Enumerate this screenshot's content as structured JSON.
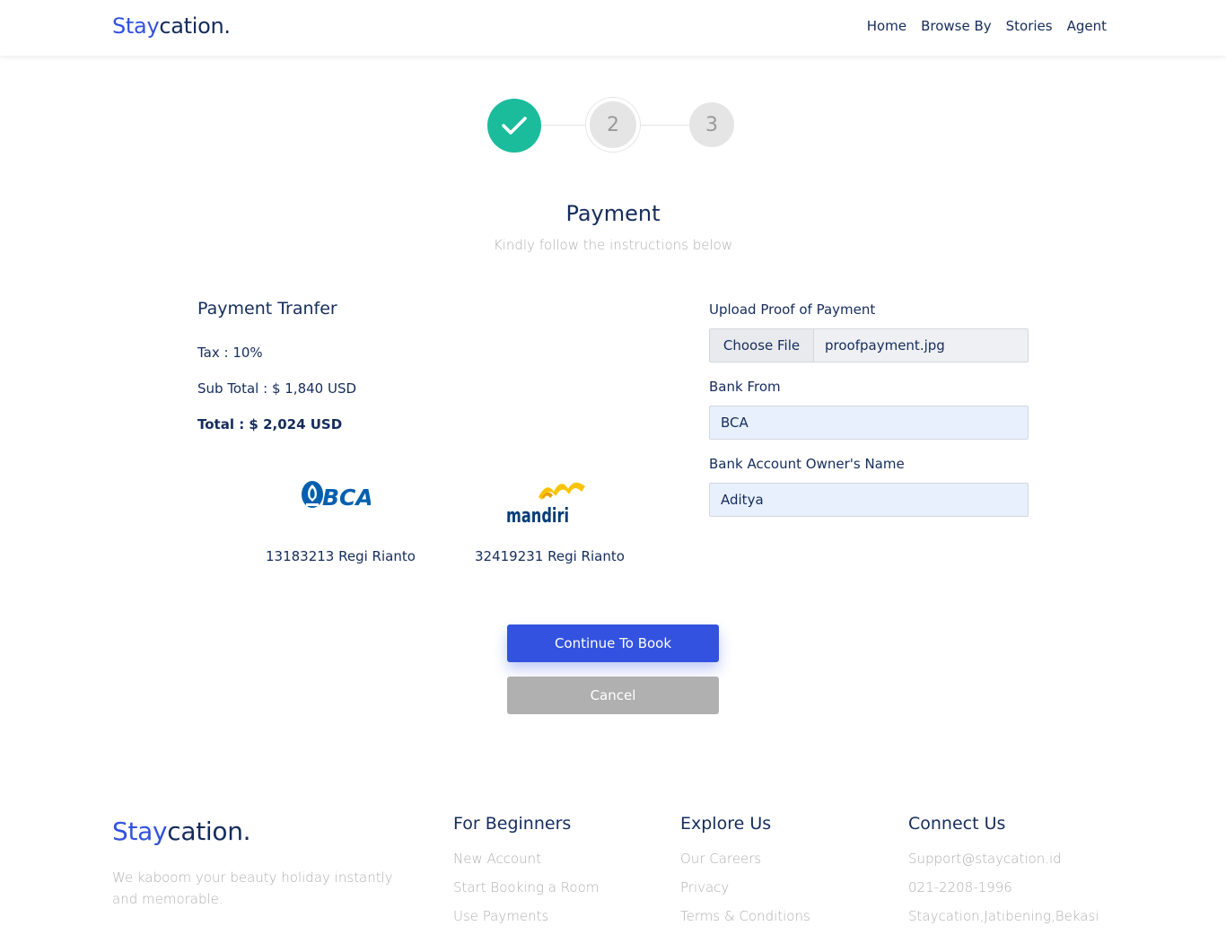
{
  "header": {
    "brand_part1": "Stay",
    "brand_part2": "cation.",
    "nav": [
      "Home",
      "Browse By",
      "Stories",
      "Agent"
    ]
  },
  "stepper": {
    "step1_state": "completed",
    "step2_label": "2",
    "step3_label": "3"
  },
  "page": {
    "title": "Payment",
    "subtitle": "Kindly follow the instructions below"
  },
  "payment": {
    "heading": "Payment Tranfer",
    "tax": "Tax : 10%",
    "subtotal": "Sub Total : $ 1,840 USD",
    "total": "Total : $ 2,024 USD",
    "banks": [
      {
        "logo": "BCA",
        "account": "13183213 Regi Rianto"
      },
      {
        "logo": "mandiri",
        "account": "32419231 Regi Rianto"
      }
    ]
  },
  "form": {
    "upload_label": "Upload Proof of Payment",
    "choose_file_label": "Choose File",
    "file_name": "proofpayment.jpg",
    "bank_from_label": "Bank From",
    "bank_from_value": "BCA",
    "owner_label": "Bank Account Owner's Name",
    "owner_value": "Aditya"
  },
  "actions": {
    "continue_label": "Continue To Book",
    "cancel_label": "Cancel"
  },
  "footer": {
    "brand_part1": "Stay",
    "brand_part2": "cation.",
    "tagline": "We kaboom your beauty holiday instantly and memorable.",
    "columns": [
      {
        "title": "For Beginners",
        "links": [
          "New Account",
          "Start Booking a Room",
          "Use Payments"
        ]
      },
      {
        "title": "Explore Us",
        "links": [
          "Our Careers",
          "Privacy",
          "Terms & Conditions"
        ]
      },
      {
        "title": "Connect Us",
        "links": [
          "Support@staycation.id",
          "021-2208-1996",
          "Staycation,Jatibening,Bekasi"
        ]
      }
    ]
  },
  "colors": {
    "primary": "#3252df",
    "dark": "#152c5b",
    "success": "#1abc9c",
    "muted": "#b0b0b0"
  }
}
